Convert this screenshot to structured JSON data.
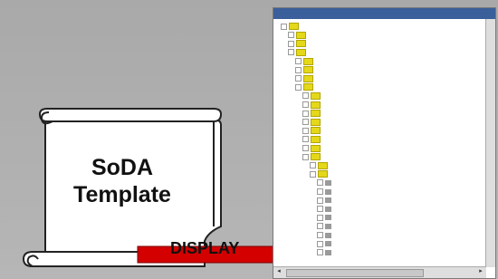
{
  "tree_window": {
    "title": "",
    "nodes": [
      {
        "depth": 0,
        "type": "folder",
        "expanded": true,
        "label": ""
      },
      {
        "depth": 1,
        "type": "folder",
        "expanded": true,
        "label": ""
      },
      {
        "depth": 1,
        "type": "folder",
        "expanded": true,
        "label": ""
      },
      {
        "depth": 1,
        "type": "folder",
        "expanded": true,
        "label": ""
      },
      {
        "depth": 2,
        "type": "folder",
        "expanded": true,
        "label": ""
      },
      {
        "depth": 2,
        "type": "folder",
        "expanded": true,
        "label": ""
      },
      {
        "depth": 2,
        "type": "folder",
        "expanded": true,
        "label": ""
      },
      {
        "depth": 2,
        "type": "folder",
        "expanded": true,
        "label": ""
      },
      {
        "depth": 3,
        "type": "folder",
        "expanded": true,
        "label": ""
      },
      {
        "depth": 3,
        "type": "folder",
        "expanded": true,
        "label": ""
      },
      {
        "depth": 3,
        "type": "folder",
        "expanded": true,
        "label": ""
      },
      {
        "depth": 3,
        "type": "folder",
        "expanded": true,
        "label": ""
      },
      {
        "depth": 3,
        "type": "folder",
        "expanded": true,
        "label": ""
      },
      {
        "depth": 3,
        "type": "folder",
        "expanded": true,
        "label": ""
      },
      {
        "depth": 3,
        "type": "folder",
        "expanded": true,
        "label": ""
      },
      {
        "depth": 3,
        "type": "folder",
        "expanded": true,
        "label": ""
      },
      {
        "depth": 4,
        "type": "folder",
        "expanded": true,
        "label": ""
      },
      {
        "depth": 4,
        "type": "folder",
        "expanded": true,
        "label": ""
      },
      {
        "depth": 5,
        "type": "leaf",
        "expanded": true,
        "label": ""
      },
      {
        "depth": 5,
        "type": "leaf",
        "expanded": true,
        "label": ""
      },
      {
        "depth": 5,
        "type": "leaf",
        "expanded": true,
        "label": ""
      },
      {
        "depth": 5,
        "type": "leaf",
        "expanded": true,
        "label": ""
      },
      {
        "depth": 5,
        "type": "leaf",
        "expanded": true,
        "label": ""
      },
      {
        "depth": 5,
        "type": "leaf",
        "expanded": true,
        "label": ""
      },
      {
        "depth": 5,
        "type": "leaf",
        "expanded": false,
        "label": ""
      },
      {
        "depth": 5,
        "type": "leaf",
        "expanded": false,
        "label": ""
      },
      {
        "depth": 5,
        "type": "leaf",
        "expanded": false,
        "label": ""
      }
    ]
  },
  "scroll_document": {
    "line1": "SoDA",
    "line2": "Template"
  },
  "arrow": {
    "label": "DISPLAY"
  },
  "colors": {
    "background": "#b0b0b0",
    "folder": "#e4d81a",
    "titlebar": "#3a5f9a",
    "arrow": "#d40000"
  }
}
